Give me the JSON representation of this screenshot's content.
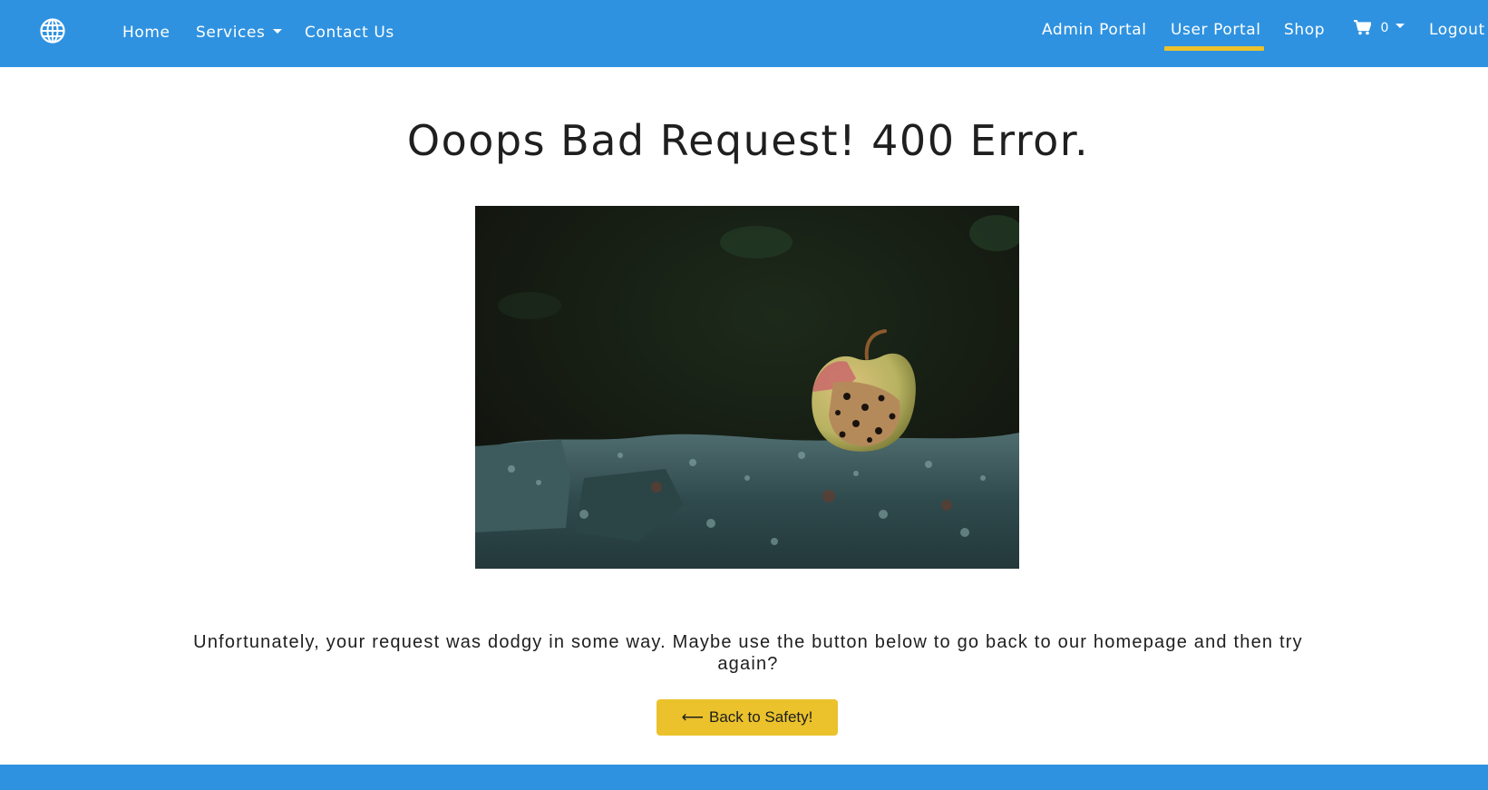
{
  "nav": {
    "left": [
      {
        "label": "Home"
      },
      {
        "label": "Services"
      },
      {
        "label": "Contact Us"
      }
    ],
    "right": [
      {
        "label": "Admin Portal"
      },
      {
        "label": "User Portal"
      },
      {
        "label": "Shop"
      },
      {
        "label": "Logout"
      }
    ],
    "cart_count": "0",
    "active": "User Portal",
    "brand_icon": "globe-icon",
    "cart_icon": "shopping-cart-icon"
  },
  "error": {
    "title": "Ooops Bad Request! 400 Error.",
    "message": "Unfortunately, your request was dodgy in some way. Maybe use the button below to go back to our homepage and then try again?",
    "button_label": "Back to Safety!",
    "button_icon": "arrow-left-icon"
  },
  "colors": {
    "navbar": "#2f92e0",
    "accent": "#ebc22c",
    "text": "#1e1e1e"
  }
}
